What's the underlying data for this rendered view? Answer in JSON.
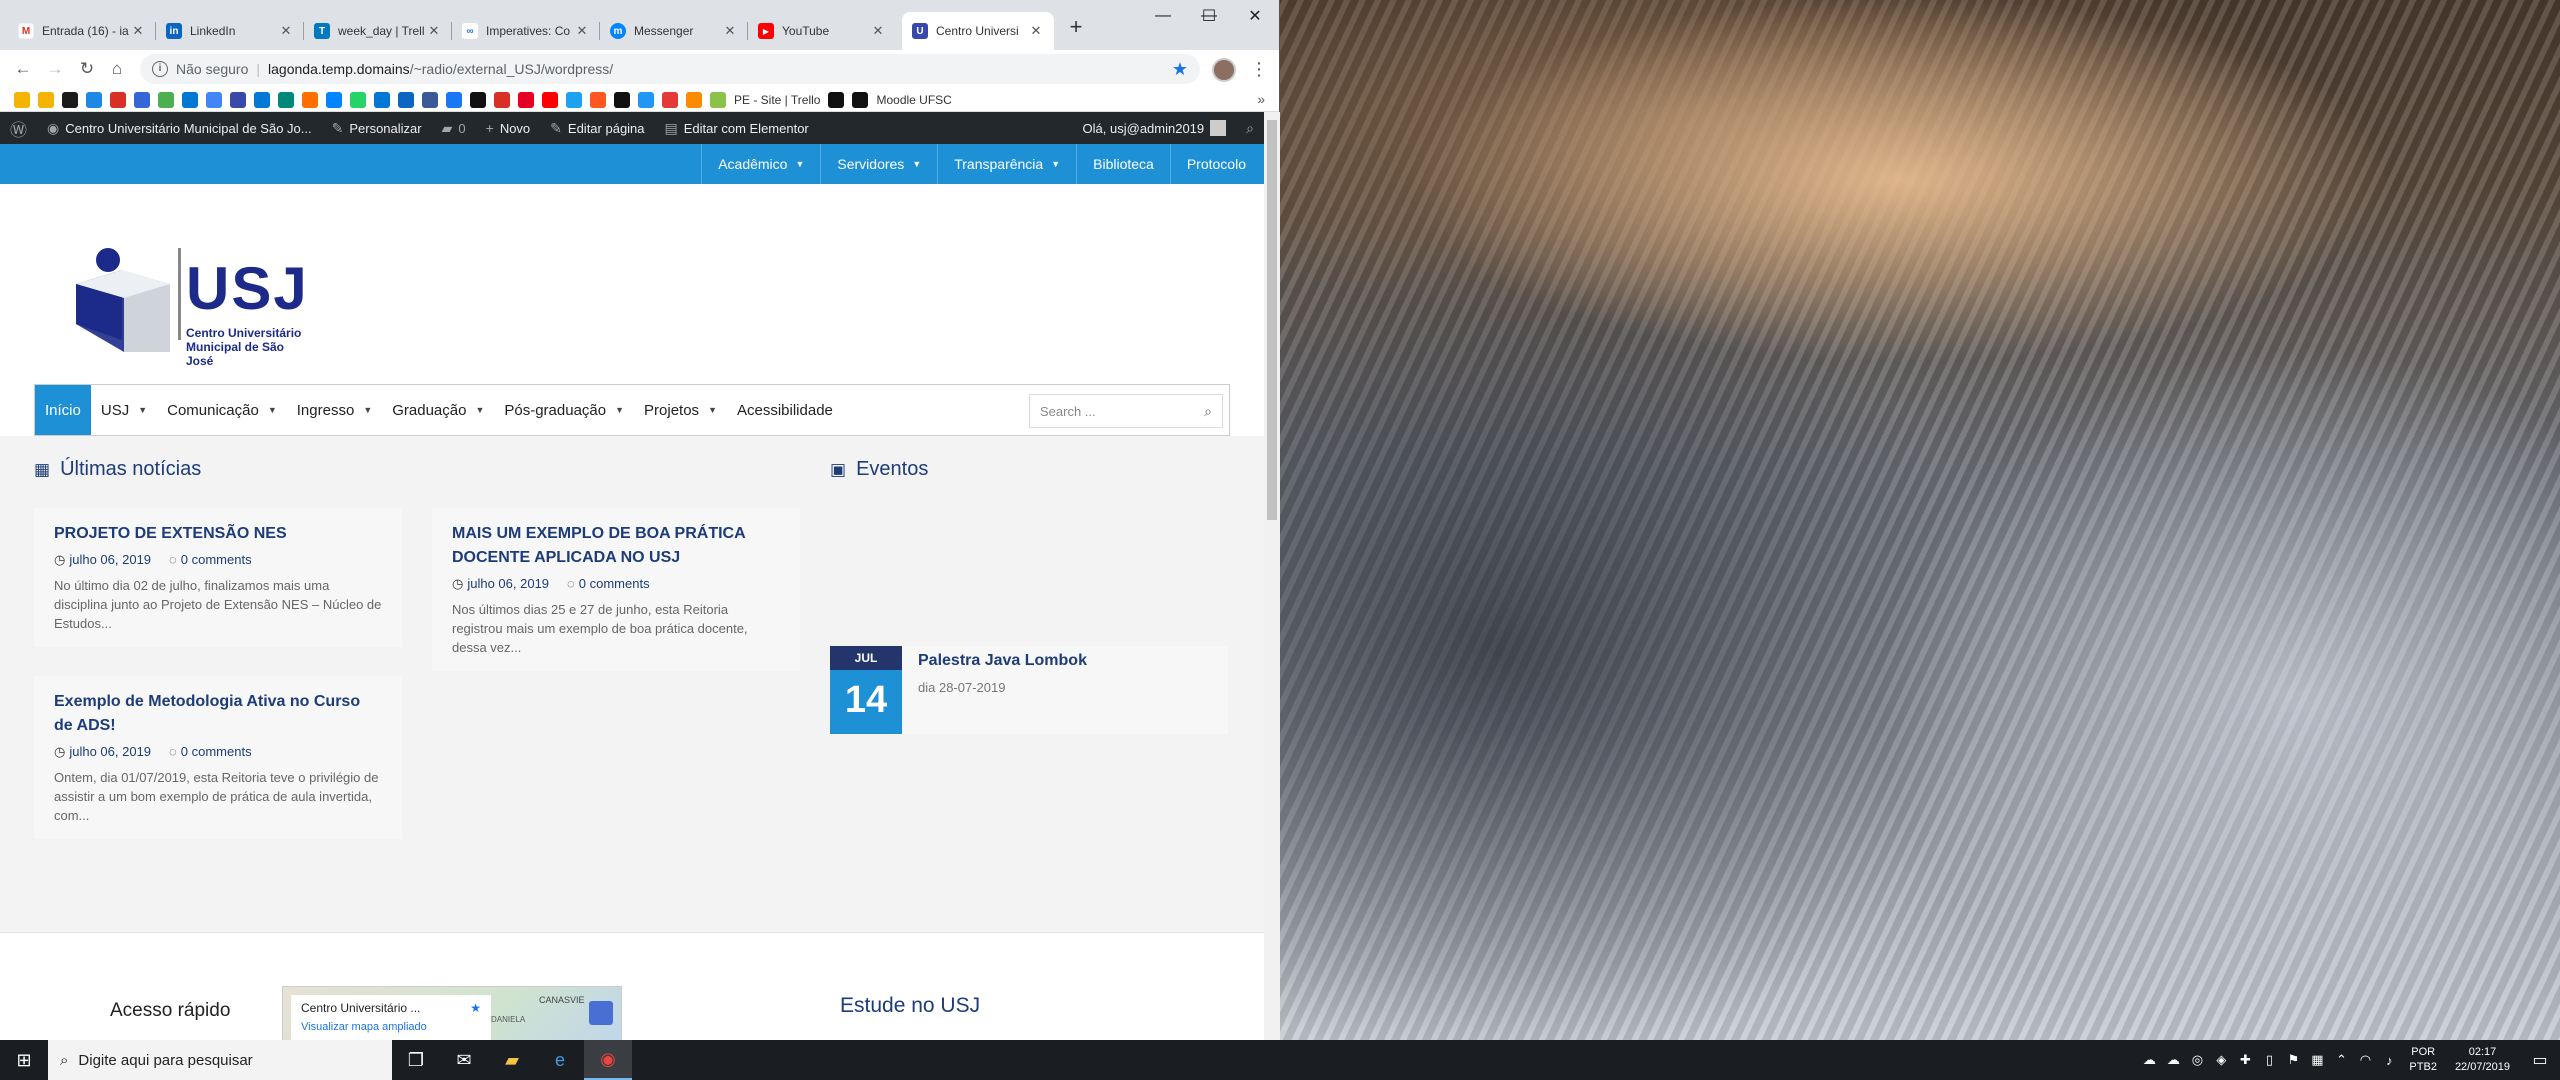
{
  "browser": {
    "tabs": [
      {
        "label": "Entrada (16) - ia",
        "color": "#d93025",
        "glyph": "M"
      },
      {
        "label": "LinkedIn",
        "color": "#0a66c2",
        "glyph": "in"
      },
      {
        "label": "week_day | Trell",
        "color": "#0079bf",
        "glyph": "T"
      },
      {
        "label": "Imperatives: Co",
        "color": "#1a73e8",
        "glyph": "∞"
      },
      {
        "label": "Messenger",
        "color": "#0084ff",
        "glyph": "m"
      },
      {
        "label": "YouTube",
        "color": "#ff0000",
        "glyph": "▶"
      },
      {
        "label": "Centro Universi",
        "color": "#3949ab",
        "glyph": "U"
      }
    ],
    "url_security": "Não seguro",
    "url_host": "lagonda.temp.domains",
    "url_path": "/~radio/external_USJ/wordpress/",
    "bookmark_texts": [
      "PE - Site | Trello",
      "Moodle UFSC"
    ],
    "bookmark_colors": [
      "#f4b400",
      "#f4b400",
      "#1b1b1b",
      "#1e88e5",
      "#d93025",
      "#3367d6",
      "#4caf50",
      "#0078d4",
      "#4285f4",
      "#3949ab",
      "#0078d4",
      "#00897b",
      "#ff6f00",
      "#0084ff",
      "#25d366",
      "#0078d4",
      "#0a66c2",
      "#3b5998",
      "#1877f2",
      "#111111",
      "#d93025",
      "#e60023",
      "#ff0000",
      "#1da1f2",
      "#ff5722",
      "#111111",
      "#2196f3",
      "#e53935",
      "#fb8c00",
      "#8bc34a",
      "#111111",
      "#111111"
    ]
  },
  "wp_admin": {
    "site_name": "Centro Universitário Municipal de São Jo...",
    "customize": "Personalizar",
    "comments": "0",
    "new": "Novo",
    "edit_page": "Editar página",
    "elementor": "Editar com Elementor",
    "greeting": "Olá, usj@admin2019"
  },
  "top_menu": [
    {
      "label": "Acadêmico",
      "caret": true
    },
    {
      "label": "Servidores",
      "caret": true
    },
    {
      "label": "Transparência",
      "caret": true
    },
    {
      "label": "Biblioteca",
      "caret": false
    },
    {
      "label": "Protocolo",
      "caret": false
    }
  ],
  "logo": {
    "title": "USJ",
    "subtitle_line1": "Centro Universitário",
    "subtitle_line2": "Municipal de São José",
    "color": "#1d2a8a"
  },
  "main_nav": [
    {
      "label": "Início",
      "caret": false,
      "active": true
    },
    {
      "label": "USJ",
      "caret": true
    },
    {
      "label": "Comunicação",
      "caret": true
    },
    {
      "label": "Ingresso",
      "caret": true
    },
    {
      "label": "Graduação",
      "caret": true
    },
    {
      "label": "Pós-graduação",
      "caret": true
    },
    {
      "label": "Projetos",
      "caret": true
    },
    {
      "label": "Acessibilidade",
      "caret": false
    }
  ],
  "search_placeholder": "Search ...",
  "news": {
    "title": "Últimas notícias",
    "items": [
      {
        "title": "PROJETO DE EXTENSÃO NES",
        "date": "julho 06, 2019",
        "comments": "0 comments",
        "excerpt": "No último dia 02 de julho, finalizamos mais uma disciplina junto ao Projeto de Extensão NES – Núcleo de Estudos..."
      },
      {
        "title": "MAIS UM EXEMPLO DE BOA PRÁTICA DOCENTE APLICADA NO USJ",
        "date": "julho 06, 2019",
        "comments": "0 comments",
        "excerpt": "Nos últimos dias 25 e 27 de junho, esta Reitoria registrou mais um exemplo de boa prática docente, dessa vez..."
      },
      {
        "title": "Exemplo de Metodologia Ativa no Curso de ADS!",
        "date": "julho 06, 2019",
        "comments": "0 comments",
        "excerpt": "Ontem, dia 01/07/2019, esta Reitoria teve o privilégio de assistir a um bom exemplo de prática de aula invertida, com..."
      }
    ]
  },
  "events": {
    "title": "Eventos",
    "items": [
      {
        "month": "JUL",
        "day": "14",
        "title": "Palestra Java Lombok",
        "when": "dia 28-07-2019"
      }
    ]
  },
  "footer": {
    "quick_access": "Acesso rápido",
    "map_title": "Centro Universitário ...",
    "map_link": "Visualizar mapa ampliado",
    "map_label1": "CANASVIE",
    "map_label2": "DANIELA",
    "study": "Estude no USJ"
  },
  "taskbar": {
    "search_placeholder": "Digite aqui para pesquisar",
    "lang": "POR",
    "layout": "PTB2",
    "time": "02:17",
    "date": "22/07/2019"
  },
  "colors": {
    "accent": "#1e90d6",
    "navy": "#1d3c78",
    "wp_bar": "#23282d"
  }
}
